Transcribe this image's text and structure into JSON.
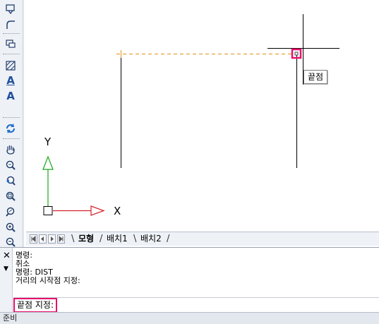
{
  "toolbar": {
    "tools": [
      {
        "icon": "select-window-icon"
      },
      {
        "icon": "fillet-icon"
      },
      {
        "icon": "block-insert-icon"
      },
      {
        "icon": "hatch-icon"
      },
      {
        "icon": "multiline-text-icon",
        "glyph": "A"
      },
      {
        "icon": "single-line-text-icon",
        "glyph": "A"
      },
      {
        "icon": "regen-icon"
      },
      {
        "icon": "pan-hand-icon"
      },
      {
        "icon": "zoom-realtime-icon"
      },
      {
        "icon": "zoom-previous-icon"
      },
      {
        "icon": "zoom-window-icon"
      },
      {
        "icon": "zoom-dynamic-icon"
      },
      {
        "icon": "zoom-in-icon"
      },
      {
        "icon": "zoom-out-icon"
      }
    ]
  },
  "canvas": {
    "ucs": {
      "x_label": "X",
      "y_label": "Y"
    },
    "snap_tooltip": "끝점",
    "colors": {
      "tracking_line": "#e7a23a",
      "snap_marker": "#e8106b",
      "y_axis": "#1aa81a",
      "x_axis": "#d4232a"
    }
  },
  "tabs": {
    "items": [
      {
        "label": "모형",
        "active": true
      },
      {
        "label": "배치1",
        "active": false
      },
      {
        "label": "배치2",
        "active": false
      }
    ]
  },
  "command": {
    "history": [
      "명령:",
      "취소",
      "명령: DIST",
      "거리의 시작점 지정:"
    ],
    "prompt": "끝점 지정:",
    "close_glyph": "✕",
    "menu_glyph": "▼"
  },
  "status": {
    "text": "준비"
  }
}
